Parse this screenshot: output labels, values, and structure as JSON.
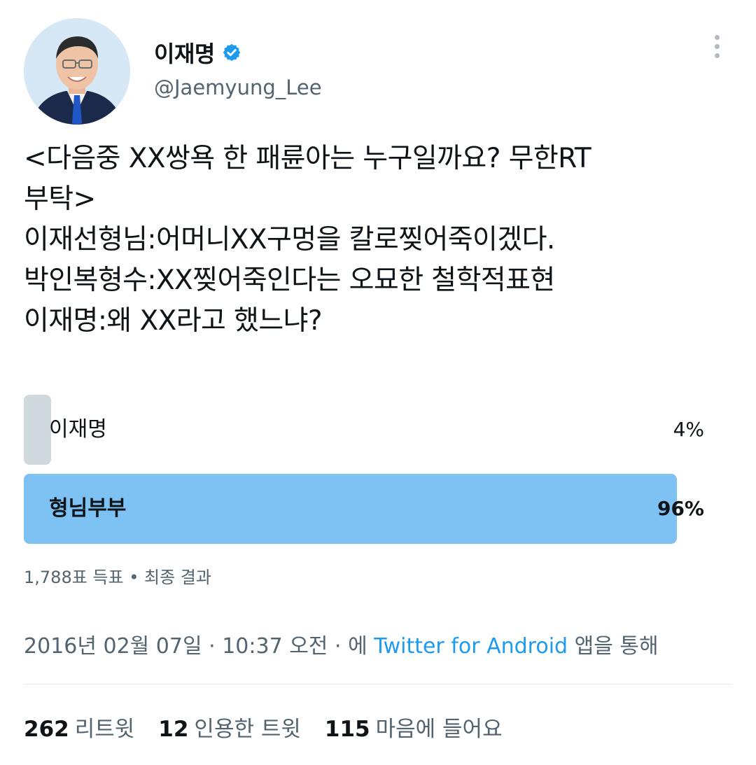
{
  "author": {
    "name": "이재명",
    "handle": "@Jaemyung_Lee",
    "verified_color": "#1d9bf0"
  },
  "tweet": {
    "lines": [
      "<다음중 XX쌍욕 한 패륜아는 누구일까요?  무한RT",
      "부탁>",
      "이재선형님:어머니XX구멍을 칼로찢어죽이겠다.",
      "박인복형수:XX찢어죽인다는 오묘한 철학적표현",
      "이재명:왜 XX라고 했느냐?"
    ]
  },
  "poll": {
    "options": [
      {
        "label": "이재명",
        "percent_text": "4%",
        "percent": 4,
        "bar_color": "#cfd9de"
      },
      {
        "label": "형님부부",
        "percent_text": "96%",
        "percent": 96,
        "bar_color": "#7dc2f3"
      }
    ],
    "votes": "1,788표 득표",
    "separator": "•",
    "status": "최종 결과"
  },
  "meta": {
    "date": "2016년 02월 07일",
    "sep1": "·",
    "time": "10:37 오전",
    "sep2": "·",
    "via_prefix": "에",
    "source": "Twitter for Android",
    "via_suffix": "앱을 통해"
  },
  "stats": {
    "retweets_count": "262",
    "retweets_label": "리트윗",
    "quotes_count": "12",
    "quotes_label": "인용한 트윗",
    "likes_count": "115",
    "likes_label": "마음에 들어요"
  }
}
